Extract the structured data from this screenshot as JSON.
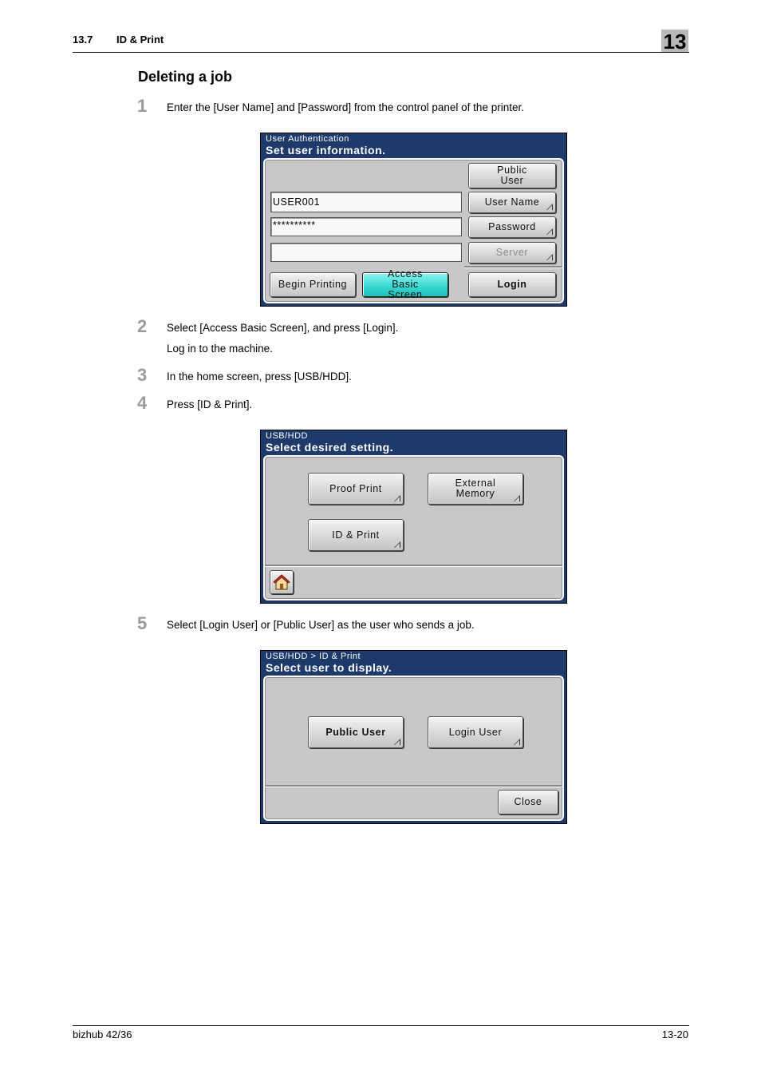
{
  "header": {
    "section_number": "13.7",
    "section_name": "ID & Print",
    "chapter": "13"
  },
  "title": "Deleting a job",
  "steps": [
    {
      "num": "1",
      "text": "Enter the [User Name] and [Password] from the control panel of the printer."
    },
    {
      "num": "2",
      "text": "Select [Access Basic Screen], and press [Login].",
      "subtext": "Log in to the machine."
    },
    {
      "num": "3",
      "text": "In the home screen, press [USB/HDD]."
    },
    {
      "num": "4",
      "text": "Press [ID & Print]."
    },
    {
      "num": "5",
      "text": "Select [Login User] or [Public User] as the user who sends a job."
    }
  ],
  "screen1": {
    "caption_small": "User Authentication",
    "caption_big": "Set user information.",
    "username_value": "USER001",
    "password_value": "**********",
    "server_value": "",
    "buttons": {
      "public_user": "Public User",
      "user_name": "User Name",
      "password": "Password",
      "server": "Server",
      "begin_printing": "Begin Printing",
      "access_basic_screen": "Access Basic Screen",
      "login": "Login"
    }
  },
  "screen2": {
    "caption_small": "USB/HDD",
    "caption_big": "Select desired setting.",
    "buttons": {
      "proof_print": "Proof Print",
      "external_memory": "External Memory",
      "id_print": "ID & Print"
    },
    "home_icon": "home-icon"
  },
  "screen3": {
    "caption_small": "USB/HDD > ID & Print",
    "caption_big": "Select user to display.",
    "buttons": {
      "public_user": "Public User",
      "login_user": "Login User",
      "close": "Close"
    }
  },
  "footer": {
    "product": "bizhub 42/36",
    "page": "13-20"
  }
}
